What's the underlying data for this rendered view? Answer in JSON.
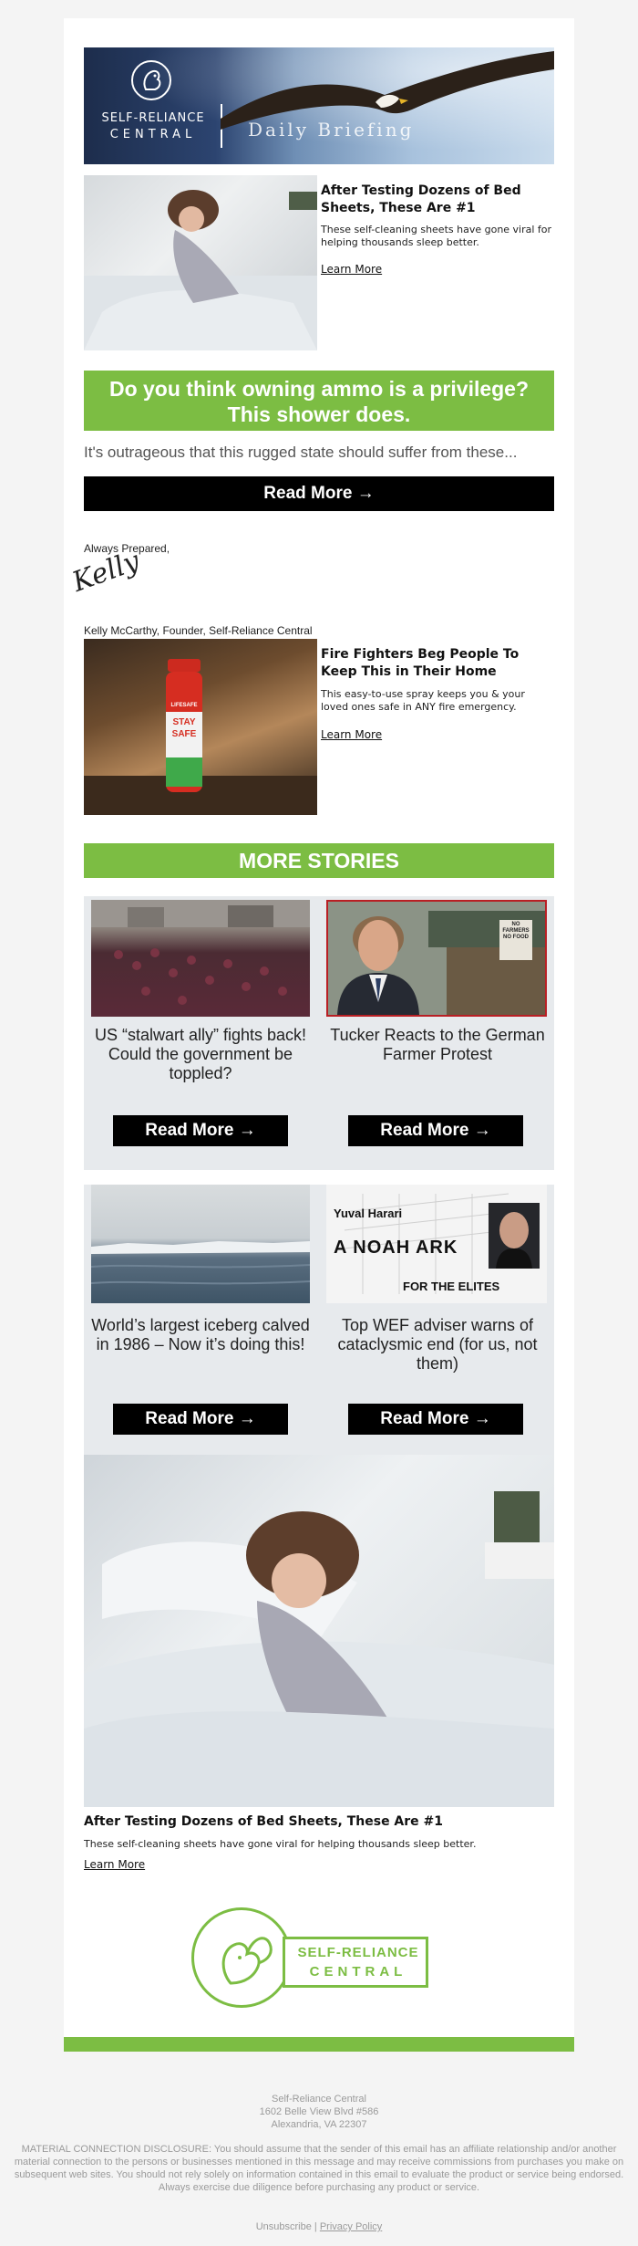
{
  "header": {
    "brand_line1": "SELF-RELIANCE",
    "brand_line2": "CENTRAL",
    "tagline": "Daily Briefing"
  },
  "ad_top": {
    "title": "After Testing Dozens of Bed Sheets, These Are #1",
    "body": "These self-cleaning sheets have gone viral for helping thousands sleep better.",
    "link": "Learn More"
  },
  "headline": {
    "text": "Do you think owning ammo is a privilege? This shower does."
  },
  "teaser": "It's outrageous that this rugged state should suffer from these...",
  "main_cta": "Read More →",
  "signoff": {
    "greeting": "Always Prepared,",
    "signature": "Kelly",
    "name": "Kelly McCarthy, Founder, Self-Reliance Central"
  },
  "ad_fire": {
    "title": "Fire Fighters Beg People To Keep This in Their Home",
    "body": "This easy-to-use spray keeps you & your loved ones safe in ANY fire emergency.",
    "link": "Learn More",
    "can_brand": "LIFESAFE",
    "can_text1": "STAY",
    "can_text2": "SAFE"
  },
  "more_stories": {
    "heading": "MORE STORIES",
    "items": [
      {
        "title": "US “stalwart ally” fights back! Could the government be toppled?",
        "cta": "Read More →"
      },
      {
        "title": "Tucker Reacts to the German Farmer Protest",
        "cta": "Read More →",
        "sign": "NO FARMERS NO FOOD"
      },
      {
        "title": "World’s largest iceberg calved in 1986 – Now it’s doing this!",
        "cta": "Read More →"
      },
      {
        "title": "Top WEF adviser warns of cataclysmic end (for us, not them)",
        "cta": "Read More →",
        "img_name": "Yuval Harari",
        "img_title": "A NOAH ARK",
        "img_sub": "FOR THE ELITES"
      }
    ]
  },
  "ad_bottom": {
    "title": "After Testing Dozens of Bed Sheets, These Are #1",
    "body": "These self-cleaning sheets have gone viral for helping thousands sleep better.",
    "link": "Learn More"
  },
  "footer_logo": {
    "line1": "SELF-RELIANCE",
    "line2": "CENTRAL"
  },
  "footer": {
    "company": "Self-Reliance Central",
    "address1": "1602 Belle View Blvd #586",
    "address2": "Alexandria, VA 22307",
    "disclosure": "MATERIAL CONNECTION DISCLOSURE: You should assume that the sender of this email has an affiliate relationship and/or another material connection to the persons or businesses mentioned in this message and may receive commissions from purchases you make on subsequent web sites. You should not rely solely on information contained in this email to evaluate the product or service being endorsed. Always exercise due diligence before purchasing any product or service.",
    "unsubscribe": "Unsubscribe",
    "separator": "|",
    "privacy": "Privacy Policy"
  },
  "colors": {
    "green": "#7cbd43",
    "black": "#000000",
    "grey_panel": "#e7eaed",
    "page_bg": "#f4f4f4"
  }
}
